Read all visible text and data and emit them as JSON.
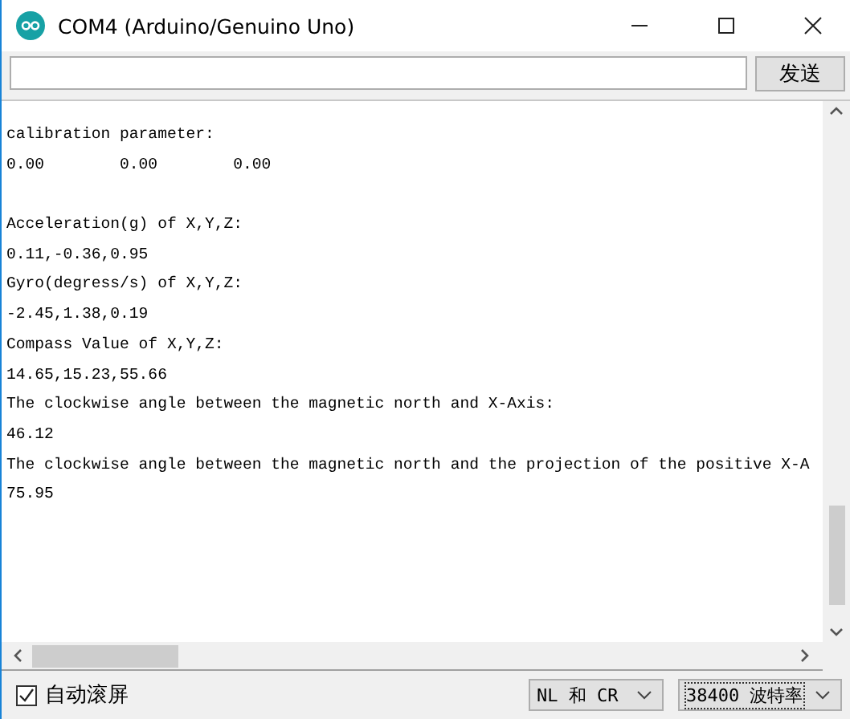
{
  "window": {
    "title": "COM4 (Arduino/Genuino Uno)"
  },
  "send_button": {
    "label": "发送"
  },
  "output_lines": [
    {
      "text": "calibration parameter:",
      "blank_before": false
    },
    {
      "text": "0.00        0.00        0.00",
      "blank_before": false
    },
    {
      "text": "Acceleration(g) of X,Y,Z:",
      "blank_before": true
    },
    {
      "text": "0.11,-0.36,0.95",
      "blank_before": false
    },
    {
      "text": "Gyro(degress/s) of X,Y,Z:",
      "blank_before": false
    },
    {
      "text": "-2.45,1.38,0.19",
      "blank_before": false
    },
    {
      "text": "Compass Value of X,Y,Z:",
      "blank_before": false
    },
    {
      "text": "14.65,15.23,55.66",
      "blank_before": false
    },
    {
      "text": "The clockwise angle between the magnetic north and X-Axis:",
      "blank_before": false
    },
    {
      "text": "46.12",
      "blank_before": false
    },
    {
      "text": "The clockwise angle between the magnetic north and the projection of the positive X-A",
      "blank_before": false
    },
    {
      "text": "75.95",
      "blank_before": false
    }
  ],
  "autoscroll": {
    "label": "自动滚屏",
    "checked": true
  },
  "line_ending": {
    "value": "NL 和 CR"
  },
  "baud_rate": {
    "value": "38400 波特率"
  }
}
